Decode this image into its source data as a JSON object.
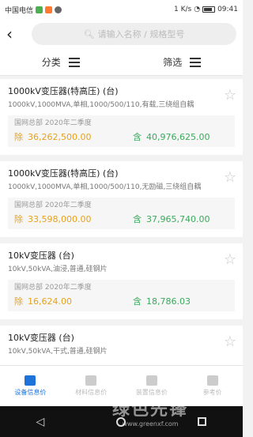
{
  "status_bar": {
    "carrier": "中国电信",
    "network_speed": "1 K/s",
    "time": "09:41"
  },
  "header": {
    "back_icon": "chevron-left-icon",
    "search_placeholder": "请输入名称 / 规格型号"
  },
  "filter_bar": {
    "category_label": "分类",
    "filter_label": "筛选"
  },
  "cards": [
    {
      "title": "1000kV变压器(特高压)   (台)",
      "spec": "1000kV,1000MVA,单相,1000/500/110,有载,三绕组自耦",
      "source": "国网总部 2020年二季度",
      "ex_label": "除",
      "ex_price": "36,262,500.00",
      "in_label": "含",
      "in_price": "40,976,625.00"
    },
    {
      "title": "1000kV变压器(特高压)   (台)",
      "spec": "1000kV,1000MVA,单相,1000/500/110,无励磁,三绕组自耦",
      "source": "国网总部 2020年二季度",
      "ex_label": "除",
      "ex_price": "33,598,000.00",
      "in_label": "含",
      "in_price": "37,965,740.00"
    },
    {
      "title": "10kV变压器   (台)",
      "spec": "10kV,50kVA,油浸,普通,硅钢片",
      "source": "国网总部 2020年二季度",
      "ex_label": "除",
      "ex_price": "16,624.00",
      "in_label": "含",
      "in_price": "18,786.03"
    },
    {
      "title": "10kV变压器   (台)",
      "spec": "10kV,50kVA,干式,普通,硅钢片"
    }
  ],
  "tab_bar": {
    "tabs": [
      {
        "label": "设备信息价",
        "active": true
      },
      {
        "label": "材料信息价",
        "active": false
      },
      {
        "label": "装置信息价",
        "active": false
      },
      {
        "label": "参考价",
        "active": false
      }
    ]
  },
  "watermark": {
    "text": "绿色先锋",
    "url": "www.greenxf.com"
  },
  "colors": {
    "accent": "#1e72d9",
    "price_excl": "#e8a21a",
    "price_incl": "#3aaa5c"
  }
}
